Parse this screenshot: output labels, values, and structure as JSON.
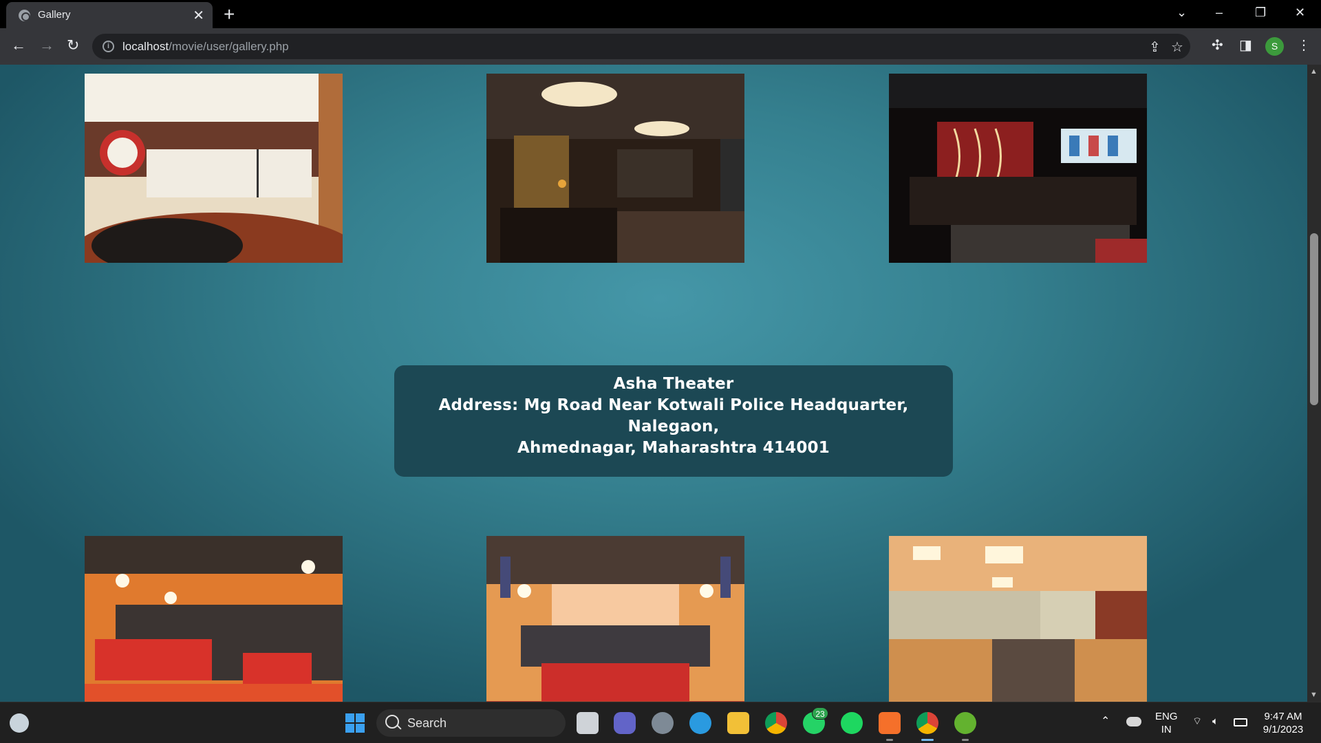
{
  "browser": {
    "tab_title": "Gallery",
    "new_tab": "+",
    "url_host": "localhost",
    "url_path": "/movie/user/gallery.php",
    "profile_initial": "S"
  },
  "page": {
    "theater_name": "Asha Theater",
    "address_line1": "Address: Mg Road Near Kotwali Police Headquarter,",
    "address_line2": "Nalegaon,",
    "address_line3": "Ahmednagar, Maharashtra 414001",
    "photos_top": [
      "refreshment-counter-photo",
      "lounge-photo",
      "recliner-auditorium-photo"
    ],
    "photos_bottom": [
      "auditorium-seats-photo",
      "auditorium-screen-view-photo",
      "lobby-corridor-photo"
    ]
  },
  "taskbar": {
    "search_label": "Search",
    "whatsapp_badge": "23",
    "lang_line1": "ENG",
    "lang_line2": "IN",
    "time": "9:47 AM",
    "date": "9/1/2023"
  }
}
